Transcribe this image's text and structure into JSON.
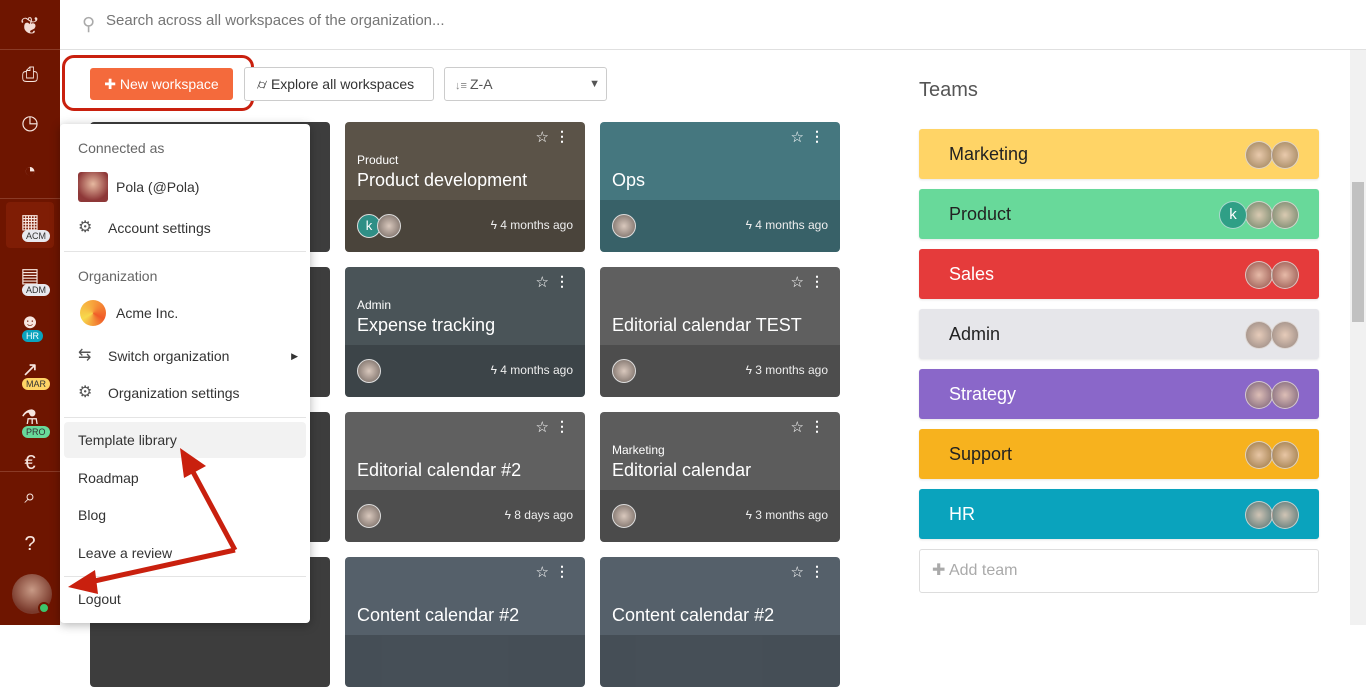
{
  "search": {
    "placeholder": "Search across all workspaces of the organization..."
  },
  "toolbar": {
    "new_workspace": "New workspace",
    "explore": "Explore all workspaces",
    "sort": "Z-A"
  },
  "sidebar": {
    "badges": [
      "ACM",
      "ADM",
      "HR",
      "MAR",
      "PRO"
    ]
  },
  "workspaces": [
    {
      "category": "Product",
      "title": "Product development",
      "time": "4 months ago",
      "bg": "#5b5348"
    },
    {
      "category": "",
      "title": "Ops",
      "time": "4 months ago",
      "bg": "#45777f"
    },
    {
      "category": "Admin",
      "title": "Expense tracking",
      "time": "4 months ago",
      "bg": "#4a5458"
    },
    {
      "category": "",
      "title": "Editorial calendar TEST",
      "time": "3 months ago",
      "bg": "#5f5f5f"
    },
    {
      "category": "",
      "title": "Editorial calendar #2",
      "time": "8 days ago",
      "bg": "#606060"
    },
    {
      "category": "Marketing",
      "title": "Editorial calendar",
      "time": "3 months ago",
      "bg": "#5c5c5c"
    },
    {
      "category": "",
      "title": "Content calendar #2",
      "time": "",
      "bg": "#55606a"
    },
    {
      "category": "",
      "title": "Content calendar #2",
      "time": "",
      "bg": "#55606a"
    }
  ],
  "teams": {
    "title": "Teams",
    "add": "Add team",
    "items": [
      {
        "name": "Marketing",
        "color": "#ffd466",
        "text": "#222"
      },
      {
        "name": "Product",
        "color": "#68d99a",
        "text": "#222"
      },
      {
        "name": "Sales",
        "color": "#e53b3b",
        "text": "#fff"
      },
      {
        "name": "Admin",
        "color": "#e6e6ea",
        "text": "#222"
      },
      {
        "name": "Strategy",
        "color": "#8a67c9",
        "text": "#fff"
      },
      {
        "name": "Support",
        "color": "#f7b21e",
        "text": "#222"
      },
      {
        "name": "HR",
        "color": "#0aa3bd",
        "text": "#fff"
      }
    ]
  },
  "menu": {
    "connected_as": "Connected as",
    "user": "Pola (@Pola)",
    "account_settings": "Account settings",
    "organization": "Organization",
    "org_name": "Acme Inc.",
    "switch_org": "Switch organization",
    "org_settings": "Organization settings",
    "template_library": "Template library",
    "roadmap": "Roadmap",
    "blog": "Blog",
    "review": "Leave a review",
    "logout": "Logout"
  }
}
